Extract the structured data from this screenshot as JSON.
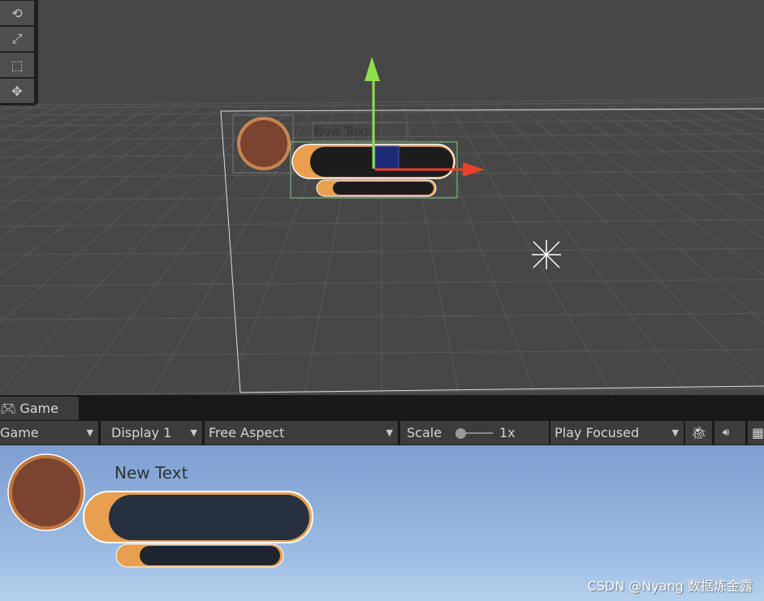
{
  "scene": {
    "tools": [
      {
        "icon": "rotate-tool-icon"
      },
      {
        "icon": "scale-tool-icon"
      },
      {
        "icon": "rect-tool-icon"
      },
      {
        "icon": "transform-tool-icon"
      }
    ],
    "ui_text": "New Text"
  },
  "game_tab": {
    "label": "Game",
    "icon": "gamepad-icon"
  },
  "toolbar": {
    "view": "Game",
    "display": "Display 1",
    "aspect": "Free Aspect",
    "scale_label": "Scale",
    "scale_value": "1x",
    "scale_slider": 0,
    "play_mode": "Play Focused"
  },
  "game": {
    "ui_text": "New Text"
  },
  "watermark": "CSDN @Nyang 数据炼金露",
  "colors": {
    "accent_orange": "#e8a050",
    "x_axis": "#e8402a",
    "y_axis": "#8ee04a",
    "sky": "#7d9ed1"
  }
}
